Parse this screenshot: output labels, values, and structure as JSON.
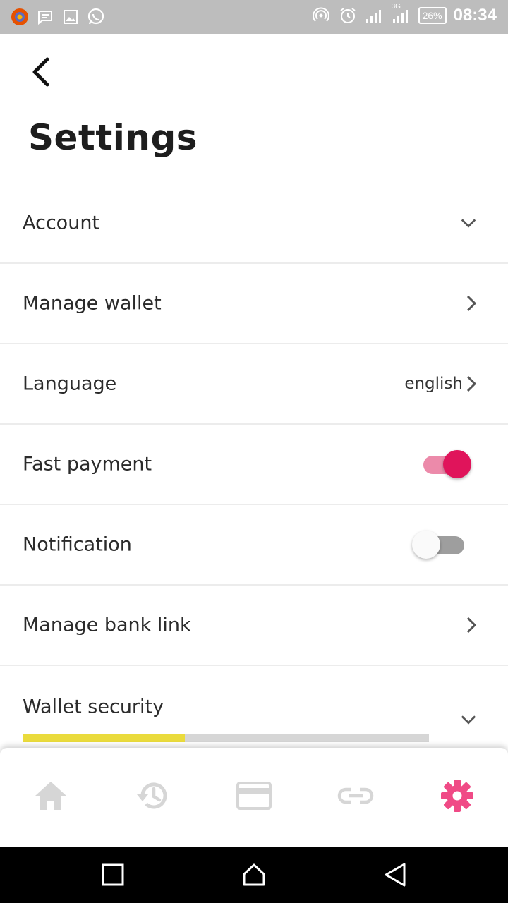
{
  "status_bar": {
    "time": "08:34",
    "battery": "26%",
    "network": "3G"
  },
  "header": {
    "title": "Settings"
  },
  "settings": {
    "account": {
      "label": "Account"
    },
    "manage_wallet": {
      "label": "Manage wallet"
    },
    "language": {
      "label": "Language",
      "value": "english"
    },
    "fast_payment": {
      "label": "Fast payment",
      "enabled": true
    },
    "notification": {
      "label": "Notification",
      "enabled": false
    },
    "manage_bank_link": {
      "label": "Manage bank link"
    },
    "wallet_security": {
      "label": "Wallet security",
      "level": 0.4
    }
  },
  "bottom_nav": {
    "items": [
      {
        "name": "home",
        "icon": "home-icon",
        "active": false
      },
      {
        "name": "history",
        "icon": "history-icon",
        "active": false
      },
      {
        "name": "card",
        "icon": "credit-card-icon",
        "active": false
      },
      {
        "name": "link",
        "icon": "link-icon",
        "active": false
      },
      {
        "name": "settings",
        "icon": "gear-icon",
        "active": true
      }
    ]
  },
  "colors": {
    "accent": "#e0145b",
    "accent_active_icon": "#f04a86",
    "inactive_icon": "#d6d6d6",
    "security_fill": "#eadb3c"
  }
}
